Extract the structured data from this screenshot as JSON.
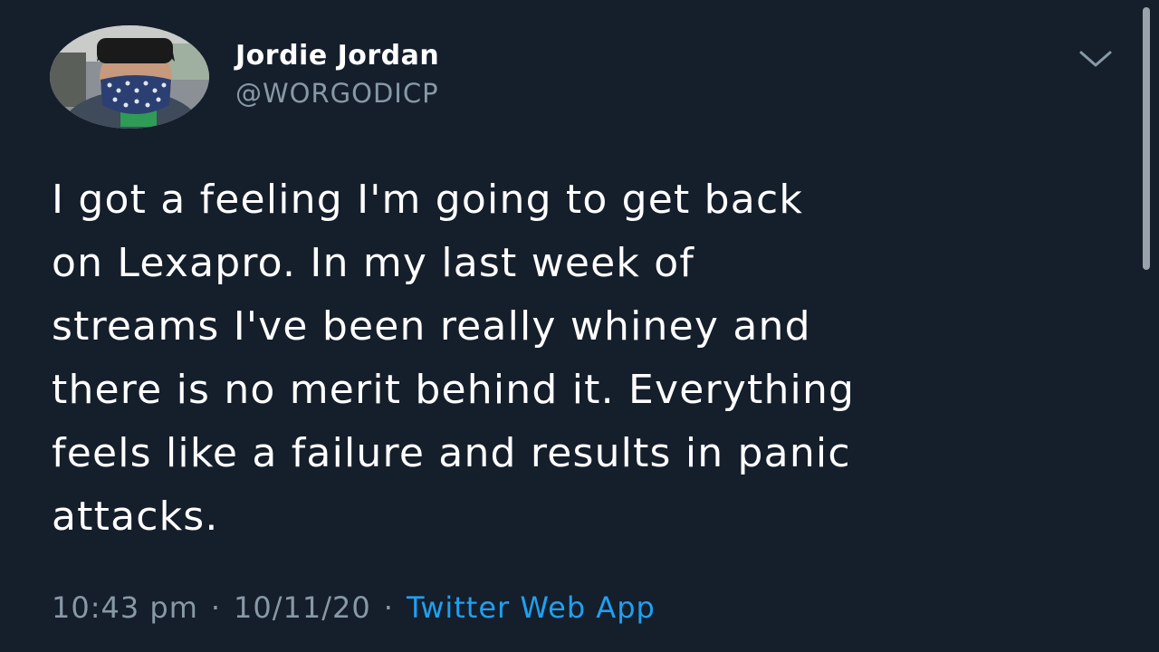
{
  "user": {
    "name": "Jordie Jordan",
    "handle": "@WORGODICP"
  },
  "tweet": {
    "lines": [
      "I got a feeling I'm going to get back",
      "on Lexapro. In my last week of",
      "streams I've been really whiney and",
      "there is no merit behind it. Everything",
      "feels like a failure and results in panic",
      "attacks."
    ],
    "time": "10:43 pm",
    "date": "10/11/20",
    "separator": "·",
    "source": "Twitter Web App"
  },
  "icons": {
    "menu": "chevron-down-icon"
  },
  "colors": {
    "background": "#151e2b",
    "secondary_text": "#8899a6",
    "link": "#1da1f2"
  }
}
